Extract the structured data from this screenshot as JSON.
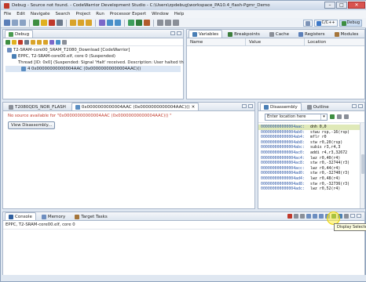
{
  "window": {
    "title": "Debug - Source not found. - CodeWarrior Development Studio - C:\\Users\\zpdebug\\workspace_PA10.4_flash-Pgmr_Demo"
  },
  "menu": [
    "File",
    "Edit",
    "Navigate",
    "Search",
    "Project",
    "Run",
    "Processor Expert",
    "Window",
    "Help"
  ],
  "perspectives": {
    "cc": "C/C++",
    "debug": "Debug"
  },
  "debug_view": {
    "tab": "Debug",
    "tree": [
      "T2-SRAM-core00_SRAM_T2080_Download [CodeWarrior]",
      "EPPC, T2-SRAM-core00.elf, core 0 (Suspended)",
      "Thread [ID: 0x0] (Suspended: Signal 'Halt' received. Description: User halted th",
      "4 0x00000000000004AAC (0x00000000000004AAC)()"
    ]
  },
  "variables_view": {
    "tabs": [
      "Variables",
      "Breakpoints",
      "Cache",
      "Registers",
      "Modules"
    ],
    "columns": [
      "Name",
      "Value",
      "Location"
    ]
  },
  "editor": {
    "tabs": [
      "T2080QDS_NOR_FLASH",
      "0x0000000000004AAC (0x0000000000004AAC)()"
    ],
    "error": "No source available for \"0x00000000000004AAC (0x00000000000004AAC)() \"",
    "button": "View Disassembly..."
  },
  "disassembly": {
    "tabs": [
      "Disassembly",
      "Outline"
    ],
    "location_placeholder": "Enter location here",
    "rows": [
      {
        "addr": "000000000000004aac:",
        "ins": "dnh 0,0"
      },
      {
        "addr": "000000000000004ab0:",
        "ins": "stwu rsp,-16(rsp)"
      },
      {
        "addr": "000000000000004ab4:",
        "ins": "mflr r0"
      },
      {
        "addr": "000000000000004ab8:",
        "ins": "stw r0,20(rsp)"
      },
      {
        "addr": "000000000000004abc:",
        "ins": "subis r3,r4,3"
      },
      {
        "addr": "000000000000004ac0:",
        "ins": "addi r4,r3,32672"
      },
      {
        "addr": "000000000000004ac4:",
        "ins": "lwz r0,40(r4)"
      },
      {
        "addr": "000000000000004ac8:",
        "ins": "stw r0,-32744(r3)"
      },
      {
        "addr": "000000000000004acc:",
        "ins": "lwz r0,44(r4)"
      },
      {
        "addr": "000000000000004ad0:",
        "ins": "stw r0,-32740(r3)"
      },
      {
        "addr": "000000000000004ad4:",
        "ins": "lwz r0,48(r4)"
      },
      {
        "addr": "000000000000004ad8:",
        "ins": "stw r0,-32736(r3)"
      },
      {
        "addr": "000000000000004adc:",
        "ins": "lwz r0,52(r4)"
      }
    ]
  },
  "console_view": {
    "tabs": [
      "Console",
      "Memory",
      "Target Tasks"
    ],
    "text": "EPPC, T2-SRAM-core00.elf, core 0"
  },
  "tooltip": "Display Selected"
}
